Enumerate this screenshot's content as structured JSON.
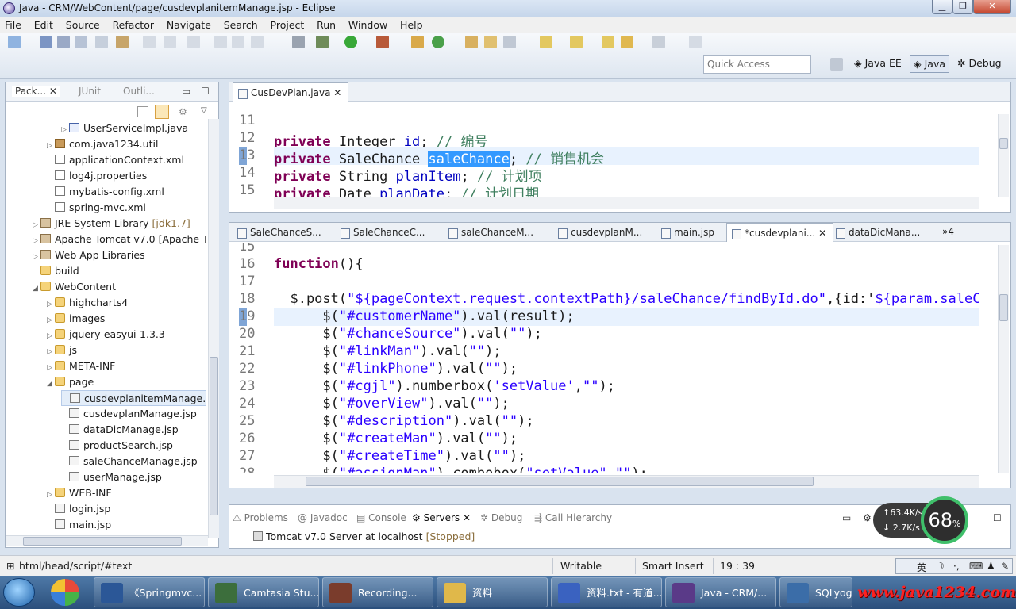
{
  "window": {
    "title": "Java - CRM/WebContent/page/cusdevplanitemManage.jsp - Eclipse"
  },
  "menu": [
    "File",
    "Edit",
    "Source",
    "Refactor",
    "Navigate",
    "Search",
    "Project",
    "Run",
    "Window",
    "Help"
  ],
  "toolbar": {
    "quick_access_placeholder": "Quick Access",
    "perspectives": {
      "java_ee": "Java EE",
      "java": "Java",
      "debug": "Debug"
    }
  },
  "left_panel": {
    "tabs": {
      "package": "Pack...",
      "junit": "JUnit",
      "outline": "Outli..."
    },
    "tree": [
      {
        "label": "UserServiceImpl.java",
        "icon": "java-file-icon",
        "indent": 4,
        "twisty": "▷"
      },
      {
        "label": "com.java1234.util",
        "icon": "package-icon",
        "indent": 3,
        "twisty": "▷"
      },
      {
        "label": "applicationContext.xml",
        "icon": "xml-file-icon",
        "indent": 3,
        "twisty": ""
      },
      {
        "label": "log4j.properties",
        "icon": "properties-file-icon",
        "indent": 3,
        "twisty": ""
      },
      {
        "label": "mybatis-config.xml",
        "icon": "xml-file-icon",
        "indent": 3,
        "twisty": ""
      },
      {
        "label": "spring-mvc.xml",
        "icon": "xml-file-icon",
        "indent": 3,
        "twisty": ""
      },
      {
        "label": "JRE System Library",
        "extra": "[jdk1.7]",
        "icon": "library-icon",
        "indent": 2,
        "twisty": "▷"
      },
      {
        "label": "Apache Tomcat v7.0 [Apache T",
        "icon": "library-icon",
        "indent": 2,
        "twisty": "▷"
      },
      {
        "label": "Web App Libraries",
        "icon": "library-icon",
        "indent": 2,
        "twisty": "▷"
      },
      {
        "label": "build",
        "icon": "folder-icon",
        "indent": 2,
        "twisty": ""
      },
      {
        "label": "WebContent",
        "icon": "folder-icon",
        "indent": 2,
        "twisty": "◢"
      },
      {
        "label": "highcharts4",
        "icon": "folder-icon",
        "indent": 3,
        "twisty": "▷"
      },
      {
        "label": "images",
        "icon": "folder-icon",
        "indent": 3,
        "twisty": "▷"
      },
      {
        "label": "jquery-easyui-1.3.3",
        "icon": "folder-icon",
        "indent": 3,
        "twisty": "▷"
      },
      {
        "label": "js",
        "icon": "folder-icon",
        "indent": 3,
        "twisty": "▷"
      },
      {
        "label": "META-INF",
        "icon": "folder-icon",
        "indent": 3,
        "twisty": "▷"
      },
      {
        "label": "page",
        "icon": "folder-icon",
        "indent": 3,
        "twisty": "◢"
      },
      {
        "label": "cusdevplanitemManage.",
        "icon": "jsp-file-icon",
        "indent": 4,
        "twisty": "",
        "selected": true
      },
      {
        "label": "cusdevplanManage.jsp",
        "icon": "jsp-file-icon",
        "indent": 4,
        "twisty": ""
      },
      {
        "label": "dataDicManage.jsp",
        "icon": "jsp-file-icon",
        "indent": 4,
        "twisty": ""
      },
      {
        "label": "productSearch.jsp",
        "icon": "jsp-file-icon",
        "indent": 4,
        "twisty": ""
      },
      {
        "label": "saleChanceManage.jsp",
        "icon": "jsp-file-icon",
        "indent": 4,
        "twisty": ""
      },
      {
        "label": "userManage.jsp",
        "icon": "jsp-file-icon",
        "indent": 4,
        "twisty": ""
      },
      {
        "label": "WEB-INF",
        "icon": "folder-icon",
        "indent": 3,
        "twisty": "▷"
      },
      {
        "label": "login.jsp",
        "icon": "jsp-file-icon",
        "indent": 3,
        "twisty": ""
      },
      {
        "label": "main.jsp",
        "icon": "jsp-file-icon",
        "indent": 3,
        "twisty": ""
      }
    ]
  },
  "editor_top": {
    "tab": "CusDevPlan.java",
    "lines": [
      {
        "n": "11",
        "tokens": []
      },
      {
        "n": "12",
        "tokens": [
          [
            "kw",
            "private"
          ],
          [
            "p",
            " Integer "
          ],
          [
            "fld",
            "id"
          ],
          [
            "p",
            "; "
          ],
          [
            "cm",
            "// 编号"
          ]
        ]
      },
      {
        "n": "13",
        "tokens": [
          [
            "kw",
            "private"
          ],
          [
            "p",
            " SaleChance "
          ],
          [
            "hl",
            "saleChance"
          ],
          [
            "p",
            "; "
          ],
          [
            "cm",
            "// 销售机会"
          ]
        ],
        "current": true
      },
      {
        "n": "14",
        "tokens": [
          [
            "kw",
            "private"
          ],
          [
            "p",
            " String "
          ],
          [
            "fld",
            "planItem"
          ],
          [
            "p",
            "; "
          ],
          [
            "cm",
            "// 计划项"
          ]
        ]
      },
      {
        "n": "15",
        "tokens": [
          [
            "kw",
            "private"
          ],
          [
            "p",
            " Date "
          ],
          [
            "fld",
            "planDate"
          ],
          [
            "p",
            "; "
          ],
          [
            "cm",
            "// 计划日期"
          ]
        ]
      }
    ]
  },
  "editor_main": {
    "tabs": [
      "SaleChanceS...",
      "SaleChanceC...",
      "saleChanceM...",
      "cusdevplanM...",
      "main.jsp",
      "*cusdevplani...",
      "dataDicMana..."
    ],
    "overflow": "»4",
    "lines": [
      {
        "n": "15",
        "tokens": []
      },
      {
        "n": "16",
        "tokens": [
          [
            "kw",
            "function"
          ],
          [
            "p",
            "(){"
          ]
        ]
      },
      {
        "n": "17",
        "tokens": []
      },
      {
        "n": "18",
        "tokens": [
          [
            "p",
            "  $.post("
          ],
          [
            "str",
            "\"${pageContext.request.contextPath}/saleChance/findById.do\""
          ],
          [
            "p",
            ",{id:'"
          ],
          [
            "str",
            "${param.saleCha"
          ]
        ]
      },
      {
        "n": "19",
        "tokens": [
          [
            "p",
            "      $("
          ],
          [
            "str",
            "\"#customerName\""
          ],
          [
            "p",
            ").val(result);"
          ]
        ],
        "current": true
      },
      {
        "n": "20",
        "tokens": [
          [
            "p",
            "      $("
          ],
          [
            "str",
            "\"#chanceSource\""
          ],
          [
            "p",
            ").val("
          ],
          [
            "str",
            "\"\""
          ],
          [
            "p",
            ");"
          ]
        ]
      },
      {
        "n": "21",
        "tokens": [
          [
            "p",
            "      $("
          ],
          [
            "str",
            "\"#linkMan\""
          ],
          [
            "p",
            ").val("
          ],
          [
            "str",
            "\"\""
          ],
          [
            "p",
            ");"
          ]
        ]
      },
      {
        "n": "22",
        "tokens": [
          [
            "p",
            "      $("
          ],
          [
            "str",
            "\"#linkPhone\""
          ],
          [
            "p",
            ").val("
          ],
          [
            "str",
            "\"\""
          ],
          [
            "p",
            ");"
          ]
        ]
      },
      {
        "n": "23",
        "tokens": [
          [
            "p",
            "      $("
          ],
          [
            "str",
            "\"#cgjl\""
          ],
          [
            "p",
            ").numberbox("
          ],
          [
            "str",
            "'setValue'"
          ],
          [
            "p",
            ","
          ],
          [
            "str",
            "\"\""
          ],
          [
            "p",
            ");"
          ]
        ]
      },
      {
        "n": "24",
        "tokens": [
          [
            "p",
            "      $("
          ],
          [
            "str",
            "\"#overView\""
          ],
          [
            "p",
            ").val("
          ],
          [
            "str",
            "\"\""
          ],
          [
            "p",
            ");"
          ]
        ]
      },
      {
        "n": "25",
        "tokens": [
          [
            "p",
            "      $("
          ],
          [
            "str",
            "\"#description\""
          ],
          [
            "p",
            ").val("
          ],
          [
            "str",
            "\"\""
          ],
          [
            "p",
            ");"
          ]
        ]
      },
      {
        "n": "26",
        "tokens": [
          [
            "p",
            "      $("
          ],
          [
            "str",
            "\"#createMan\""
          ],
          [
            "p",
            ").val("
          ],
          [
            "str",
            "\"\""
          ],
          [
            "p",
            ");"
          ]
        ]
      },
      {
        "n": "27",
        "tokens": [
          [
            "p",
            "      $("
          ],
          [
            "str",
            "\"#createTime\""
          ],
          [
            "p",
            ").val("
          ],
          [
            "str",
            "\"\""
          ],
          [
            "p",
            ");"
          ]
        ]
      },
      {
        "n": "28",
        "tokens": [
          [
            "p",
            "      $("
          ],
          [
            "str",
            "\"#assignMan\""
          ],
          [
            "p",
            ").combobox("
          ],
          [
            "str",
            "\"setValue\""
          ],
          [
            "p",
            ","
          ],
          [
            "str",
            "\"\""
          ],
          [
            "p",
            ");"
          ]
        ]
      }
    ]
  },
  "bottom_panel": {
    "tabs": [
      "Problems",
      "Javadoc",
      "Console",
      "Servers",
      "Debug",
      "Call Hierarchy"
    ],
    "active_tab": "Servers",
    "server_entry": "Tomcat v7.0 Server at localhost",
    "server_state": "[Stopped]"
  },
  "status_bar": {
    "path": "html/head/script/#text",
    "writable": "Writable",
    "insert_mode": "Smart Insert",
    "position": "19 : 39",
    "ime": "英"
  },
  "net_widget": {
    "up": "↑63.4K/s",
    "down": "↓ 2.7K/s",
    "percent": "68",
    "unit": "%"
  },
  "taskbar": {
    "tasks": [
      {
        "label": "《Springmvc...",
        "color": "#2b5797"
      },
      {
        "label": "Camtasia Stu...",
        "color": "#3c6e3c"
      },
      {
        "label": "Recording...",
        "color": "#7a3c2c"
      },
      {
        "label": "资料",
        "color": "#e0b84a"
      },
      {
        "label": "资料.txt - 有道...",
        "color": "#3a62c0"
      },
      {
        "label": "Java - CRM/...",
        "color": "#5a3a88"
      },
      {
        "label": "SQLyog 企",
        "color": "#3b6da8"
      }
    ],
    "watermark": "www.java1234.com"
  }
}
